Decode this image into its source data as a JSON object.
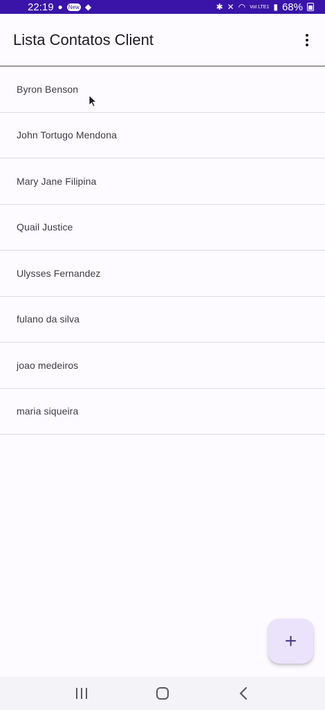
{
  "status_bar": {
    "time": "22:19",
    "pill_label": "New",
    "lte_label": "VoI LTE1",
    "battery": "68%"
  },
  "app_bar": {
    "title": "Lista Contatos Client"
  },
  "contacts": [
    {
      "name": "Byron Benson"
    },
    {
      "name": "John Tortugo Mendona"
    },
    {
      "name": "Mary Jane Filipina"
    },
    {
      "name": "Quail Justice"
    },
    {
      "name": "Ulysses Fernandez"
    },
    {
      "name": "fulano da silva"
    },
    {
      "name": "joao medeiros"
    },
    {
      "name": "maria siqueira"
    }
  ],
  "fab": {
    "icon": "plus-icon",
    "label": "+"
  },
  "colors": {
    "status_bar": "#3a13a8",
    "background": "#fdfbff",
    "fab": "#ebe3fb",
    "fab_icon": "#4a3e8c"
  }
}
